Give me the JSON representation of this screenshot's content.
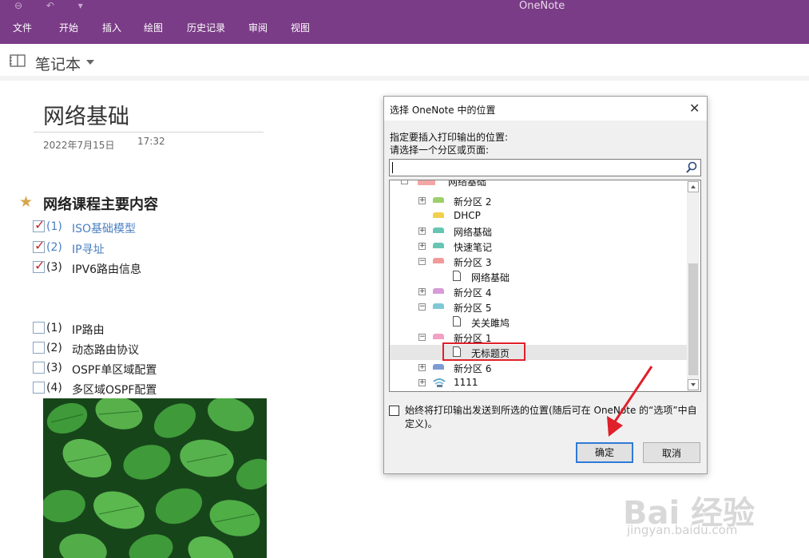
{
  "app": {
    "title": "OneNote"
  },
  "ribbon": {
    "tabs": [
      "文件",
      "开始",
      "插入",
      "绘图",
      "历史记录",
      "审阅",
      "视图"
    ]
  },
  "notebook": {
    "name": "笔记本"
  },
  "page": {
    "title": "网络基础",
    "date": "2022年7月15日",
    "time": "17:32",
    "heading": "网络课程主要内容",
    "checked_items": [
      {
        "num": "(1)",
        "text": "ISO基础模型",
        "done": true
      },
      {
        "num": "(2)",
        "text": "IP寻址",
        "done": true
      },
      {
        "num": "(3)",
        "text": "IPV6路由信息",
        "done": true
      }
    ],
    "todo_items": [
      {
        "num": "(1)",
        "text": "IP路由",
        "done": false
      },
      {
        "num": "(2)",
        "text": "动态路由协议",
        "done": false
      },
      {
        "num": "(3)",
        "text": "OSPF单区域配置",
        "done": false
      },
      {
        "num": "(4)",
        "text": "多区域OSPF配置",
        "done": false
      }
    ]
  },
  "dialog": {
    "title": "选择 OneNote 中的位置",
    "prompt1": "指定要插入打印输出的位置:",
    "prompt2": "请选择一个分区或页面:",
    "tree": [
      {
        "label": "网络基础",
        "type": "notebook",
        "expander": "−",
        "color": "#f4a6a6"
      },
      {
        "label": "新分区 2",
        "type": "section",
        "expander": "+",
        "color": "#9dcf6a"
      },
      {
        "label": "DHCP",
        "type": "section",
        "expander": "",
        "color": "#f2cf4a"
      },
      {
        "label": "网络基础",
        "type": "section",
        "expander": "+",
        "color": "#66c6b3"
      },
      {
        "label": "快速笔记",
        "type": "section",
        "expander": "+",
        "color": "#66c6b3"
      },
      {
        "label": "新分区 3",
        "type": "section",
        "expander": "−",
        "color": "#f19a9a"
      },
      {
        "label": "网络基础",
        "type": "page",
        "expander": "",
        "color": ""
      },
      {
        "label": "新分区 4",
        "type": "section",
        "expander": "+",
        "color": "#d89bd8"
      },
      {
        "label": "新分区 5",
        "type": "section",
        "expander": "−",
        "color": "#7fc8d6"
      },
      {
        "label": "关关雎鸠",
        "type": "page",
        "expander": "",
        "color": ""
      },
      {
        "label": "新分区 1",
        "type": "section",
        "expander": "−",
        "color": "#f2a0c4"
      },
      {
        "label": "无标题页",
        "type": "page",
        "expander": "",
        "color": "",
        "selected": true
      },
      {
        "label": "新分区 6",
        "type": "section",
        "expander": "+",
        "color": "#7d9ad6"
      },
      {
        "label": "1111",
        "type": "section-group",
        "expander": "+",
        "color": "#5fa7c8"
      }
    ],
    "always_label": "始终将打印输出发送到所选的位置(随后可在 OneNote 的“选项”中自定义)。",
    "ok_label": "确定",
    "cancel_label": "取消"
  },
  "watermark": {
    "logo": "Bai 经验",
    "url": "jingyan.baidu.com"
  },
  "colors": {
    "ribbon": "#7b3c87",
    "check": "#c62828",
    "link": "#4a7fc1",
    "highlight": "#e0202a"
  }
}
